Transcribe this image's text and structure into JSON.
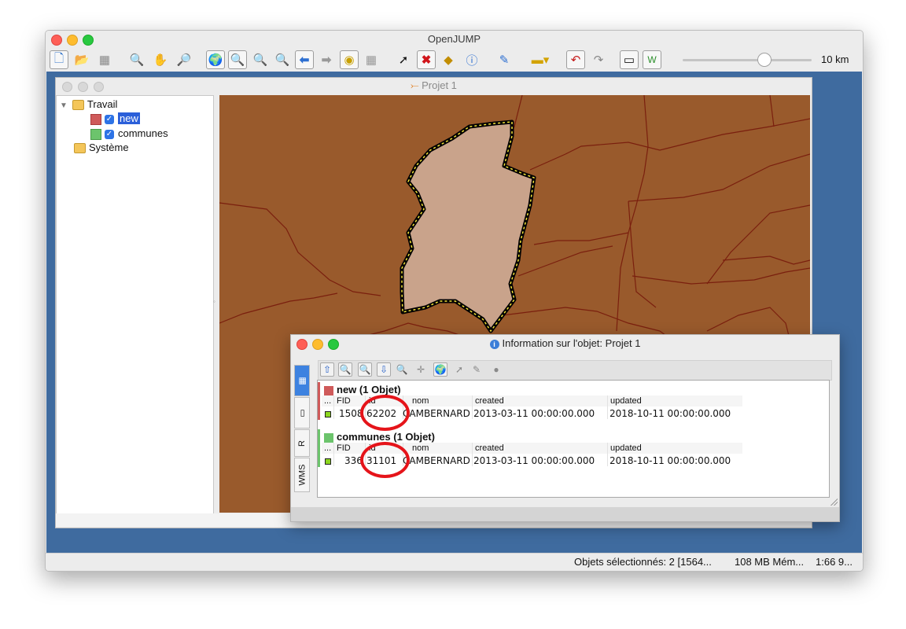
{
  "app": {
    "title": "OpenJUMP",
    "zoom_scale": "10 km"
  },
  "toolbar": {
    "icons": [
      "new-project-icon",
      "open-folder-icon",
      "save-icon",
      "zoom-tool-icon",
      "pan-hand-icon",
      "zoom-realtime-icon",
      "zoom-full-extent-icon",
      "zoom-selected-icon",
      "zoom-to-fence-icon",
      "zoom-layer-icon",
      "previous-view-icon",
      "next-view-icon",
      "scale-icon",
      "grid-icon",
      "select-arrow-icon",
      "delete-selection-icon",
      "box-icon",
      "info-icon",
      "edit-pen-icon",
      "measure-ruler-icon",
      "undo-icon",
      "redo-icon",
      "window-icon",
      "workbench-icon"
    ]
  },
  "project": {
    "title": "Projet 1",
    "tree": {
      "folder_travail": "Travail",
      "layer_new": "new",
      "layer_communes": "communes",
      "folder_systeme": "Système"
    }
  },
  "info_dialog": {
    "title": "Information sur l'objet: Projet 1",
    "side_tabs": [
      "grid-tab",
      "page-tab",
      "R",
      "WMS"
    ],
    "layers": [
      {
        "header": "new (1 Objet)",
        "color": "#cf5a5a",
        "columns": [
          "...",
          "FID",
          "id",
          "nom",
          "created",
          "updated"
        ],
        "row": {
          "fid": "1508",
          "id": "62202",
          "nom": "CAMBERNARD",
          "created": "2013-03-11 00:00:00.000",
          "updated": "2018-10-11 00:00:00.000"
        }
      },
      {
        "header": "communes (1 Objet)",
        "color": "#6cc46c",
        "columns": [
          "...",
          "FID",
          "id",
          "nom",
          "created",
          "updated"
        ],
        "row": {
          "fid": "336",
          "id": "31101",
          "nom": "CAMBERNARD",
          "created": "2013-03-11 00:00:00.000",
          "updated": "2018-10-11 00:00:00.000"
        }
      }
    ]
  },
  "status": {
    "selection": "Objets sélectionnés: 2 [1564...",
    "memory": "108 MB Mém...",
    "scale": "1:66 9..."
  },
  "colors": {
    "map_fill": "#995a2c",
    "selected_polygon": "#c9a38b",
    "desktop": "#3f6b9f",
    "annotation_circle": "#e5141a"
  }
}
